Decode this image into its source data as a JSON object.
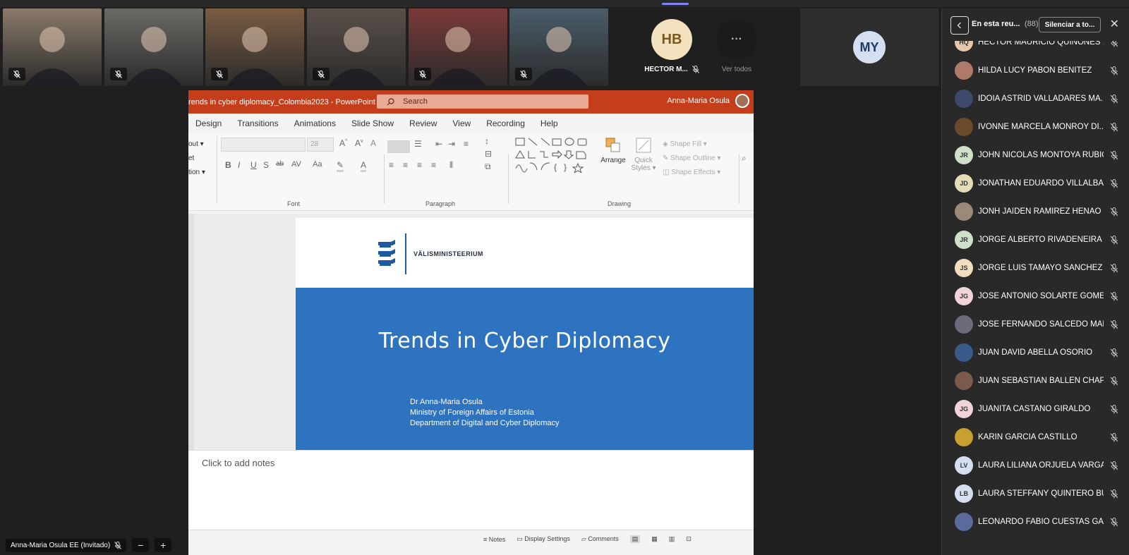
{
  "meeting": {
    "self_name": "Anna-Maria Osula EE (Invitado)",
    "zoom_out": "−",
    "zoom_in": "+"
  },
  "video_strip": {
    "tiles": [
      {
        "name": "participant-1",
        "bg": "#8a7a6a"
      },
      {
        "name": "participant-2",
        "bg": "#6c6a66"
      },
      {
        "name": "participant-3",
        "bg": "#7b5c43"
      },
      {
        "name": "participant-4",
        "bg": "#5a504a"
      },
      {
        "name": "participant-5",
        "bg": "#7a3a38"
      },
      {
        "name": "participant-6",
        "bg": "#4a5d6a"
      }
    ],
    "hb": {
      "initials": "HB",
      "label": "HECTOR M..."
    },
    "more": {
      "glyph": "···",
      "label": "Ver todos"
    },
    "my": {
      "initials": "MY"
    }
  },
  "powerpoint": {
    "doc_title": "rends in cyber diplomacy_Colombia2023  -  PowerPoint",
    "search_placeholder": "Search",
    "user": "Anna-Maria Osula",
    "tabs": [
      "Design",
      "Transitions",
      "Animations",
      "Slide Show",
      "Review",
      "View",
      "Recording",
      "Help"
    ],
    "left_cut": [
      "out ▾",
      "et",
      "tion ▾"
    ],
    "font_size": "28",
    "groups": {
      "font": "Font",
      "paragraph": "Paragraph",
      "drawing": "Drawing"
    },
    "drawing_buttons": {
      "arrange": "Arrange",
      "quick": "Quick",
      "styles": "Styles ▾",
      "shape_fill": "Shape Fill ▾",
      "shape_outline": "Shape Outline ▾",
      "shape_effects": "Shape Effects ▾"
    },
    "slide": {
      "logo_text": "VÄLISMINISTEERIUM",
      "title": "Trends in Cyber Diplomacy",
      "author_lines": [
        "Dr Anna-Maria Osula",
        "Ministry of Foreign Affairs of Estonia",
        "Department of Digital and Cyber Diplomacy"
      ]
    },
    "notes_placeholder": "Click to add notes",
    "status": {
      "notes": "Notes",
      "display": "Display Settings",
      "comments": "Comments"
    }
  },
  "panel": {
    "title": "En esta reu...",
    "count": "(88)",
    "mute_all": "Silenciar a to...",
    "participants": [
      {
        "initials": "HQ",
        "name": "HECTOR MAURICIO QUIÑONES ...",
        "color": "#e6c6a8",
        "photo": false
      },
      {
        "initials": "",
        "name": "HILDA LUCY PABON BENITEZ",
        "color": "#b07a6a",
        "photo": true
      },
      {
        "initials": "",
        "name": "IDOIA ASTRID VALLADARES MA...",
        "color": "#3b4a6a",
        "photo": true
      },
      {
        "initials": "",
        "name": "IVONNE MARCELA MONROY DI...",
        "color": "#6a4a2a",
        "photo": true
      },
      {
        "initials": "JR",
        "name": "JOHN NICOLAS MONTOYA RUBIO",
        "color": "#cfe0c8",
        "photo": false
      },
      {
        "initials": "JD",
        "name": "JONATHAN EDUARDO VILLALBA...",
        "color": "#e4ddb8",
        "photo": false
      },
      {
        "initials": "",
        "name": "JONH JAIDEN RAMIREZ HENAO",
        "color": "#9a8a7a",
        "photo": true
      },
      {
        "initials": "JR",
        "name": "JORGE ALBERTO RIVADENEIRA R...",
        "color": "#cfe0c8",
        "photo": false
      },
      {
        "initials": "JS",
        "name": "JORGE LUIS TAMAYO SANCHEZ",
        "color": "#f3ddc0",
        "photo": false
      },
      {
        "initials": "JG",
        "name": "JOSE ANTONIO SOLARTE GOMEZ",
        "color": "#f0d4d8",
        "photo": false
      },
      {
        "initials": "",
        "name": "JOSE FERNANDO SALCEDO MAR...",
        "color": "#6a6a7a",
        "photo": true
      },
      {
        "initials": "",
        "name": "JUAN DAVID ABELLA OSORIO",
        "color": "#3a5a8a",
        "photo": true
      },
      {
        "initials": "",
        "name": "JUAN SEBASTIAN BALLEN CHAP...",
        "color": "#7a5a4a",
        "photo": true
      },
      {
        "initials": "JG",
        "name": "JUANITA CASTAÑO GIRALDO",
        "color": "#f0d4d8",
        "photo": false
      },
      {
        "initials": "",
        "name": "KARIN GARCIA CASTILLO",
        "color": "#c8a030",
        "photo": true
      },
      {
        "initials": "LV",
        "name": "LAURA LILIANA ORJUELA VARGAS",
        "color": "#d4dff2",
        "photo": false
      },
      {
        "initials": "LB",
        "name": "LAURA STEFFANY QUINTERO BU...",
        "color": "#d4dff2",
        "photo": false
      },
      {
        "initials": "",
        "name": "LEONARDO FABIO CUESTAS GA...",
        "color": "#5a6a9a",
        "photo": true
      }
    ]
  }
}
